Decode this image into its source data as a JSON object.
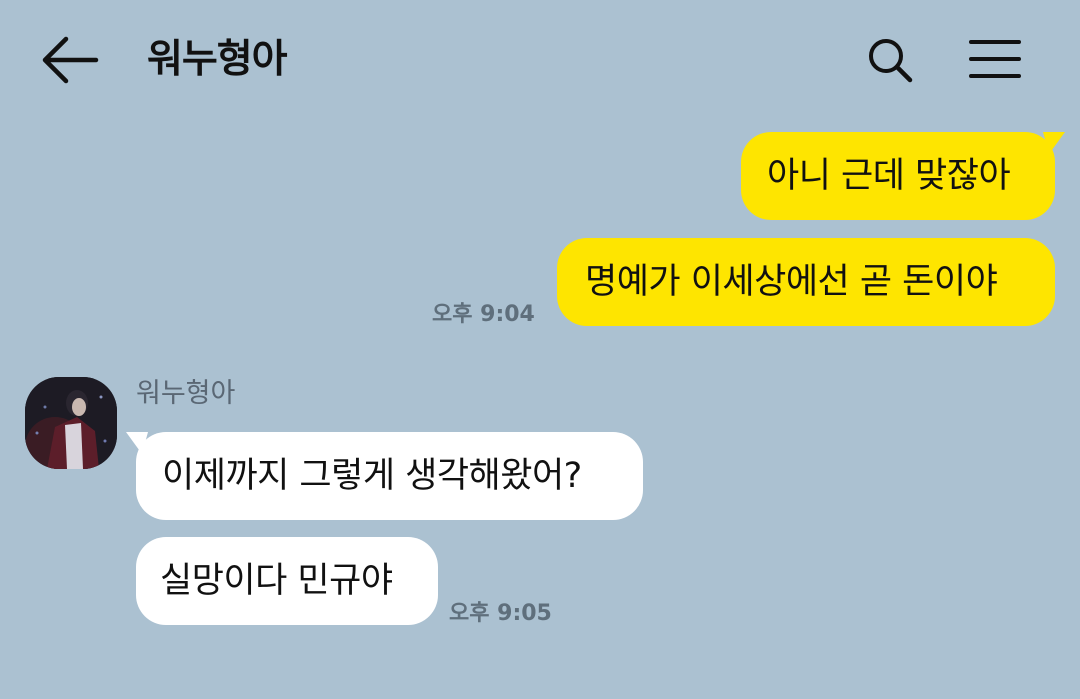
{
  "header": {
    "title": "워누형아",
    "back_icon": "arrow-left-icon",
    "search_icon": "search-icon",
    "menu_icon": "hamburger-menu-icon"
  },
  "colors": {
    "background": "#abc1d1",
    "my_bubble": "#fee500",
    "their_bubble": "#ffffff",
    "timestamp": "#5f6f7c"
  },
  "messages": {
    "outgoing": [
      {
        "text": "아니 근데 맞잖아"
      },
      {
        "text": "명예가 이세상에선 곧 돈이야"
      }
    ],
    "outgoing_time": "오후 9:04",
    "incoming_sender": "워누형아",
    "incoming": [
      {
        "text": "이제까지 그렇게 생각해왔어?"
      },
      {
        "text": "실망이다 민규야"
      }
    ],
    "incoming_time": "오후 9:05"
  }
}
